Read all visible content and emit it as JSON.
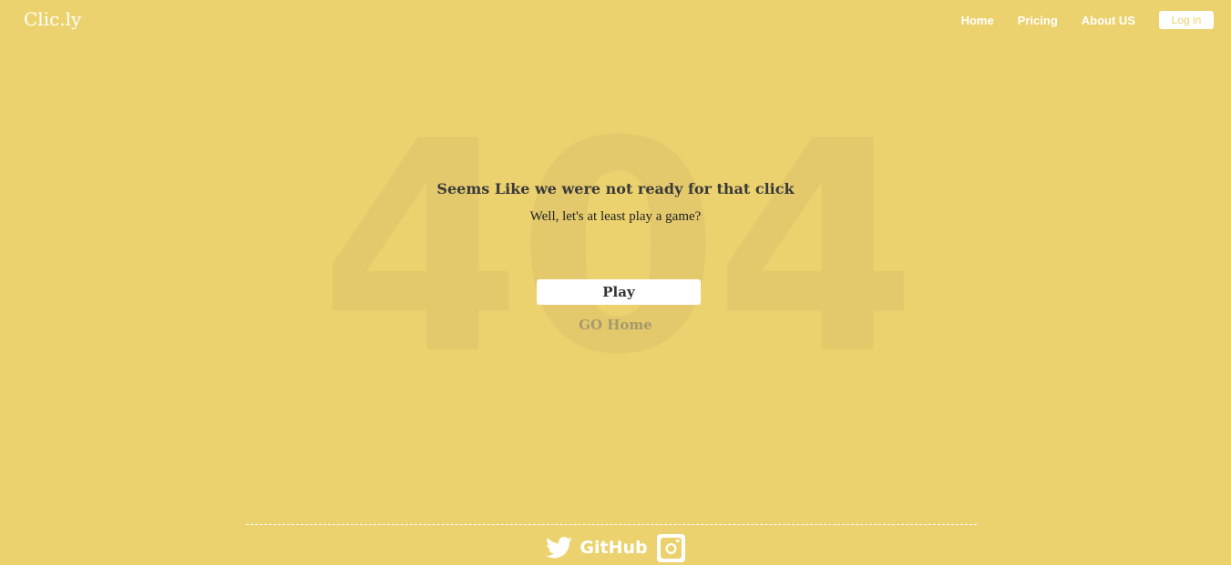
{
  "header": {
    "brand": "Clic.ly",
    "nav": [
      {
        "label": "Home"
      },
      {
        "label": "Pricing"
      },
      {
        "label": "About US"
      }
    ],
    "login_label": "Log in"
  },
  "main": {
    "background_code": "404",
    "headline": "Seems Like we were not ready for that click",
    "subline": "Well, let's at least play a game?",
    "play_label": "Play",
    "home_link": "GO Home"
  },
  "footer": {
    "twitter_icon": "twitter-icon",
    "github_label": "GitHub",
    "instagram_icon": "instagram-icon"
  },
  "colors": {
    "background": "#EBD26E",
    "text_dark": "#3a3a3a",
    "muted": "#A59A6C",
    "white": "#ffffff"
  }
}
